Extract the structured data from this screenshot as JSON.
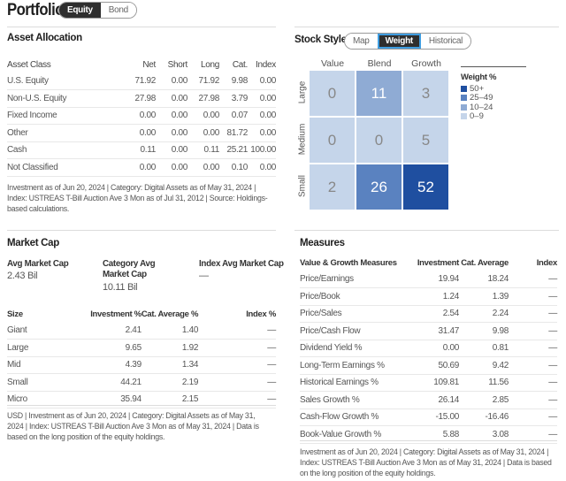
{
  "header": {
    "title": "Portfolio",
    "toggle": [
      {
        "label": "Equity",
        "active": true
      },
      {
        "label": "Bond",
        "active": false
      }
    ]
  },
  "asset_allocation": {
    "title": "Asset Allocation",
    "columns": [
      "Asset Class",
      "Net",
      "Short",
      "Long",
      "Cat.",
      "Index"
    ],
    "rows": [
      [
        "U.S. Equity",
        "71.92",
        "0.00",
        "71.92",
        "9.98",
        "0.00"
      ],
      [
        "Non-U.S. Equity",
        "27.98",
        "0.00",
        "27.98",
        "3.79",
        "0.00"
      ],
      [
        "Fixed Income",
        "0.00",
        "0.00",
        "0.00",
        "0.07",
        "0.00"
      ],
      [
        "Other",
        "0.00",
        "0.00",
        "0.00",
        "81.72",
        "0.00"
      ],
      [
        "Cash",
        "0.11",
        "0.00",
        "0.11",
        "25.21",
        "100.00"
      ],
      [
        "Not Classified",
        "0.00",
        "0.00",
        "0.00",
        "0.10",
        "0.00"
      ]
    ],
    "note": "Investment as of Jun 20, 2024 | Category: Digital Assets as of May 31, 2024 | Index: USTREAS T-Bill Auction Ave 3 Mon as of Jul 31, 2012 | Source: Holdings-based calculations."
  },
  "stock_style": {
    "title": "Stock Style",
    "toggle": [
      {
        "label": "Map",
        "active": false
      },
      {
        "label": "Weight",
        "active": true
      },
      {
        "label": "Historical",
        "active": false
      }
    ],
    "columns": [
      "Value",
      "Blend",
      "Growth"
    ],
    "rows": [
      "Large",
      "Medium",
      "Small"
    ],
    "values": [
      [
        0,
        11,
        3
      ],
      [
        0,
        0,
        5
      ],
      [
        2,
        26,
        52
      ]
    ],
    "legend": {
      "title": "Weight %",
      "items": [
        {
          "label": "50+",
          "color": "#1f4fa0"
        },
        {
          "label": "25–49",
          "color": "#5a82c0"
        },
        {
          "label": "10–24",
          "color": "#8fabd4"
        },
        {
          "label": "0–9",
          "color": "#c5d5ea"
        }
      ]
    }
  },
  "market_cap": {
    "title": "Market Cap",
    "summary": [
      {
        "label": "Avg Market Cap",
        "value": "2.43 Bil"
      },
      {
        "label": "Category Avg Market Cap",
        "value": "10.11 Bil"
      },
      {
        "label": "Index Avg Market Cap",
        "value": "—"
      }
    ],
    "columns": [
      "Size",
      "Investment %",
      "Cat. Average %",
      "Index %"
    ],
    "rows": [
      [
        "Giant",
        "2.41",
        "1.40",
        "—"
      ],
      [
        "Large",
        "9.65",
        "1.92",
        "—"
      ],
      [
        "Mid",
        "4.39",
        "1.34",
        "—"
      ],
      [
        "Small",
        "44.21",
        "2.19",
        "—"
      ],
      [
        "Micro",
        "35.94",
        "2.15",
        "—"
      ]
    ],
    "note": "USD | Investment as of Jun 20, 2024 | Category: Digital Assets as of May 31, 2024 | Index: USTREAS T-Bill Auction Ave 3 Mon as of May 31, 2024 | Data is based on the long position of the equity holdings."
  },
  "measures": {
    "title": "Measures",
    "columns": [
      "Value & Growth Measures",
      "Investment",
      "Cat. Average",
      "Index"
    ],
    "rows": [
      [
        "Price/Earnings",
        "19.94",
        "18.24",
        "—"
      ],
      [
        "Price/Book",
        "1.24",
        "1.39",
        "—"
      ],
      [
        "Price/Sales",
        "2.54",
        "2.24",
        "—"
      ],
      [
        "Price/Cash Flow",
        "31.47",
        "9.98",
        "—"
      ],
      [
        "Dividend Yield %",
        "0.00",
        "0.81",
        "—"
      ],
      [
        "Long-Term Earnings %",
        "50.69",
        "9.42",
        "—"
      ],
      [
        "Historical Earnings %",
        "109.81",
        "11.56",
        "—"
      ],
      [
        "Sales Growth %",
        "26.14",
        "2.85",
        "—"
      ],
      [
        "Cash-Flow Growth %",
        "-15.00",
        "-16.46",
        "—"
      ],
      [
        "Book-Value Growth %",
        "5.88",
        "3.08",
        "—"
      ]
    ],
    "note": "Investment as of Jun 20, 2024 | Category: Digital Assets as of May 31, 2024 | Index: USTREAS T-Bill Auction Ave 3 Mon as of May 31, 2024 | Data is based on the long position of the equity holdings."
  }
}
